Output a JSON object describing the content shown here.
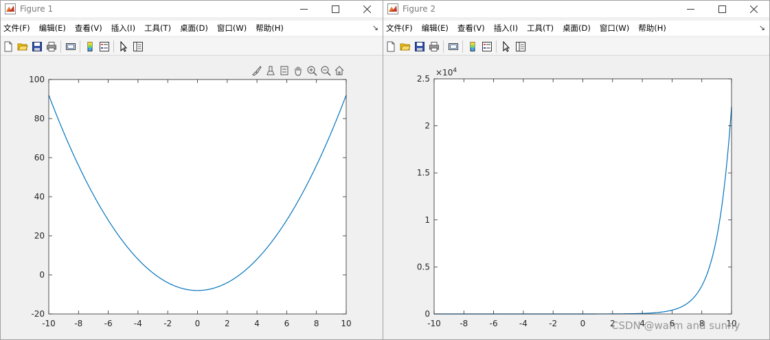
{
  "colors": {
    "line": "#0072bd",
    "axes_bg": "#ffffff",
    "figure_bg": "#f0f0f0"
  },
  "windows": [
    {
      "title": "Figure 1",
      "menu": [
        "文件(F)",
        "编辑(E)",
        "查看(V)",
        "插入(I)",
        "工具(T)",
        "桌面(D)",
        "窗口(W)",
        "帮助(H)"
      ],
      "menu_overflow": "↘",
      "axes_toolbar": [
        "brush-icon",
        "data-tip-icon",
        "legend-icon",
        "pan-icon",
        "zoom-in-icon",
        "zoom-out-icon",
        "home-icon"
      ]
    },
    {
      "title": "Figure 2",
      "menu": [
        "文件(F)",
        "编辑(E)",
        "查看(V)",
        "插入(I)",
        "工具(T)",
        "桌面(D)",
        "窗口(W)",
        "帮助(H)"
      ],
      "menu_overflow": "↘"
    }
  ],
  "chart_data": [
    {
      "type": "line",
      "function": "x^2 - 8",
      "x_range": [
        -10,
        10
      ],
      "xlim": [
        -10,
        10
      ],
      "ylim": [
        -20,
        100
      ],
      "xticks": [
        "-10",
        "-8",
        "-6",
        "-4",
        "-2",
        "0",
        "2",
        "4",
        "6",
        "8",
        "10"
      ],
      "yticks": [
        "-20",
        "0",
        "20",
        "40",
        "60",
        "80",
        "100"
      ],
      "sample_points": [
        [
          -10,
          92
        ],
        [
          -8,
          56
        ],
        [
          -6,
          28
        ],
        [
          -4,
          8
        ],
        [
          -2,
          -4
        ],
        [
          0,
          -8
        ],
        [
          2,
          -4
        ],
        [
          4,
          8
        ],
        [
          6,
          28
        ],
        [
          8,
          56
        ],
        [
          10,
          92
        ]
      ]
    },
    {
      "type": "line",
      "function": "exp(x)",
      "x_range": [
        -10,
        10
      ],
      "xlim": [
        -10,
        10
      ],
      "ylim": [
        0,
        2.5
      ],
      "y_exponent_base": "×10",
      "y_exponent_power": "4",
      "xticks": [
        "-10",
        "-8",
        "-6",
        "-4",
        "-2",
        "0",
        "2",
        "4",
        "6",
        "8",
        "10"
      ],
      "yticks": [
        "0",
        "0.5",
        "1",
        "1.5",
        "2",
        "2.5"
      ],
      "sample_points": [
        [
          -10,
          4.5e-06
        ],
        [
          0,
          0.0001
        ],
        [
          4,
          0.0055
        ],
        [
          6,
          0.0403
        ],
        [
          8,
          0.2981
        ],
        [
          9,
          0.8103
        ],
        [
          10,
          2.2026
        ]
      ]
    }
  ],
  "watermark": "CSDN @warm and sunny"
}
